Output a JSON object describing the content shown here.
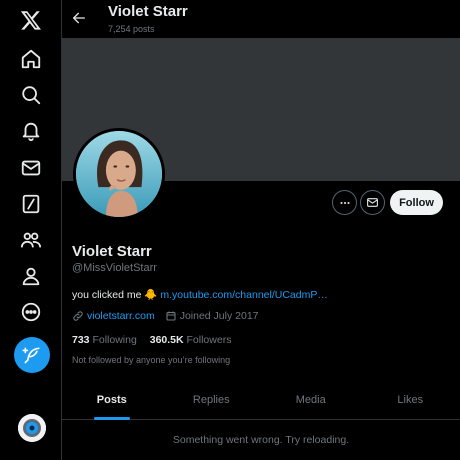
{
  "nav": {
    "items": [
      {
        "icon": "x-logo-icon"
      },
      {
        "icon": "home-icon"
      },
      {
        "icon": "search-icon"
      },
      {
        "icon": "notifications-bell-icon"
      },
      {
        "icon": "messages-envelope-icon"
      },
      {
        "icon": "grok-slash-icon"
      },
      {
        "icon": "communities-icon"
      },
      {
        "icon": "profile-icon"
      },
      {
        "icon": "more-circle-icon"
      }
    ],
    "post_button_icon": "feather-plus-icon"
  },
  "header": {
    "title": "Violet Starr",
    "posts_count": "7,254 posts"
  },
  "profile": {
    "name": "Violet Starr",
    "handle": "@MissVioletStarr",
    "bio_text": "you clicked me 🐥 ",
    "bio_link": "m.youtube.com/channel/UCadmP…",
    "website": "violetstarr.com",
    "joined": "Joined July 2017",
    "following_count": "733",
    "following_label": "Following",
    "followers_count": "360.5K",
    "followers_label": "Followers",
    "not_followed": "Not followed by anyone you’re following",
    "follow_label": "Follow"
  },
  "tabs": [
    {
      "label": "Posts",
      "active": true
    },
    {
      "label": "Replies",
      "active": false
    },
    {
      "label": "Media",
      "active": false
    },
    {
      "label": "Likes",
      "active": false
    }
  ],
  "feed": {
    "error": "Something went wrong. Try reloading."
  },
  "colors": {
    "accent": "#1d9bf0",
    "background": "#000000",
    "banner": "#333639",
    "muted_text": "#71767b"
  }
}
